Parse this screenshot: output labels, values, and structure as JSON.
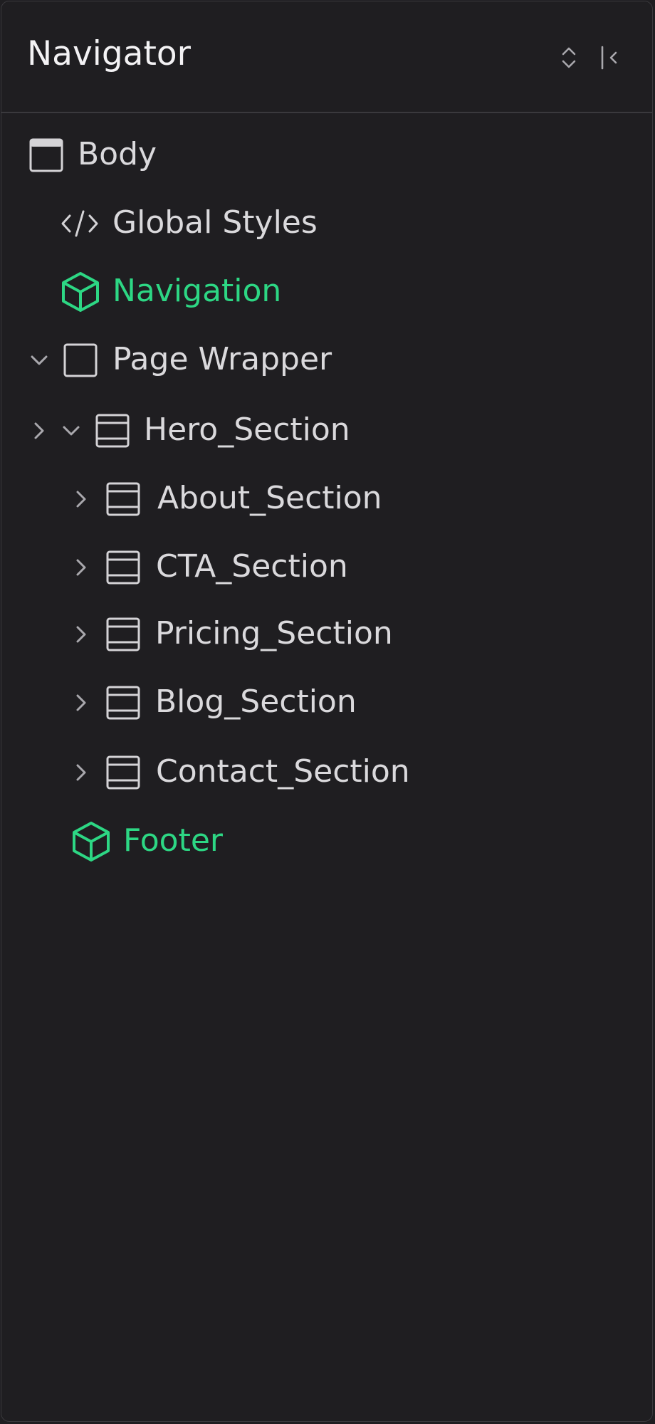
{
  "panel": {
    "title": "Navigator",
    "expand_collapse_icon": "chevron-up-down-icon",
    "collapse_panel_icon": "collapse-left-icon"
  },
  "tree": [
    {
      "label": "Body",
      "icon": "body-icon",
      "type": "element"
    },
    {
      "label": "Global Styles",
      "icon": "code-icon",
      "type": "embed"
    },
    {
      "label": "Navigation",
      "icon": "component-cube-icon",
      "type": "component"
    },
    {
      "label": "Page Wrapper",
      "icon": "div-block-icon",
      "type": "element",
      "expanded": true
    },
    {
      "label": "Hero_Section",
      "icon": "section-icon",
      "type": "element",
      "expanded": true
    },
    {
      "label": "About_Section",
      "icon": "section-icon",
      "type": "element",
      "expanded": false
    },
    {
      "label": "CTA_Section",
      "icon": "section-icon",
      "type": "element",
      "expanded": false
    },
    {
      "label": "Pricing_Section",
      "icon": "section-icon",
      "type": "element",
      "expanded": false
    },
    {
      "label": "Blog_Section",
      "icon": "section-icon",
      "type": "element",
      "expanded": false
    },
    {
      "label": "Contact_Section",
      "icon": "section-icon",
      "type": "element",
      "expanded": false
    },
    {
      "label": "Footer",
      "icon": "component-cube-icon",
      "type": "component"
    }
  ],
  "colors": {
    "background": "#1f1e21",
    "border": "#3a393d",
    "text": "#dad9dc",
    "component": "#2dd784",
    "icon": "#d4d3d6"
  }
}
